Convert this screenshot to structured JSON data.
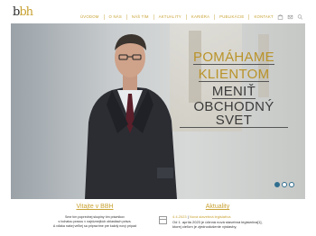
{
  "brand": {
    "logo_text_a": "b",
    "logo_text_b": "bh"
  },
  "nav": {
    "items": [
      {
        "label": "ÚVODOM"
      },
      {
        "label": "O NÁS"
      },
      {
        "label": "NÁŠ TÍM"
      },
      {
        "label": "AKTUALITY"
      },
      {
        "label": "KARIÉRA"
      },
      {
        "label": "PUBLIKÁCIE"
      },
      {
        "label": "KONTAKT"
      }
    ]
  },
  "hero": {
    "line1": "POMÁHAME",
    "line2": "KLIENTOM",
    "line3": "MENIŤ",
    "line4": "OBCHODNÝ SVET",
    "slides": 3,
    "active_slide": 1
  },
  "welcome": {
    "title": "Vitajte v BBH",
    "text1": "Sme tím poprednej skupiny tím právnikov",
    "text2": "s bohatou praxou v najrôznejších oblastiach práva.",
    "text3": "A vďaka našej veľkej sa pripravíme pre každý nový prípad"
  },
  "news": {
    "title": "Aktuality",
    "item": {
      "date": "4.4.2023",
      "headline": "Nová stavebná legislatíva",
      "text": "Od 1. apríla 2023 je účinná nová stavebná legislatíva[1], ktorej cieľom je zjednodušenie výstavby,"
    }
  },
  "colors": {
    "accent": "#c8a233",
    "text": "#333333",
    "dot": "#2f6e8f"
  }
}
